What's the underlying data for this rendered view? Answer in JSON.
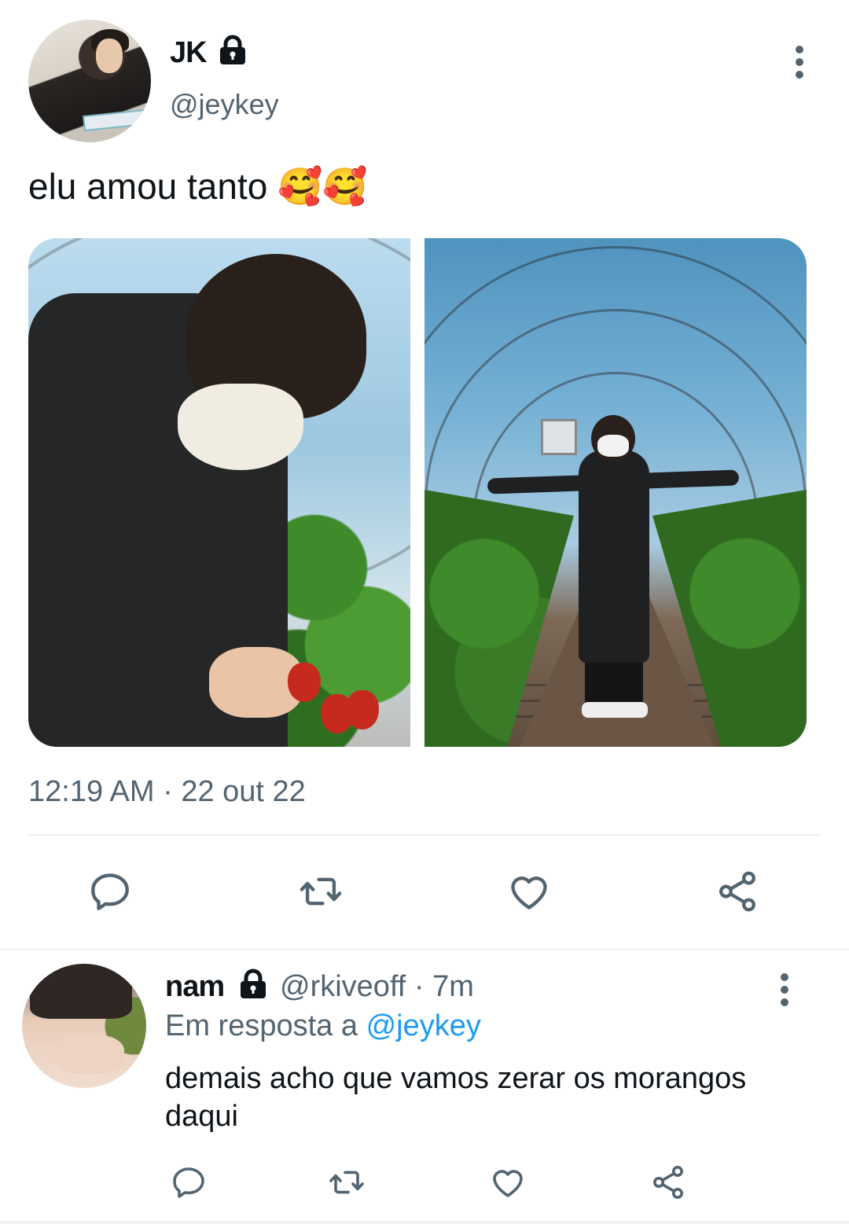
{
  "tweet": {
    "display_name": "JK",
    "handle": "@jeykey",
    "text": "elu amou tanto",
    "emoji": "🥰🥰",
    "timestamp": "12:19 AM · 22 out 22"
  },
  "reply": {
    "display_name": "nam",
    "handle_time": "@rkiveoff · 7m",
    "reply_prefix": "Em resposta a",
    "reply_mention": "@jeykey",
    "text": "demais acho que vamos zerar os morangos daqui"
  },
  "icons": {
    "lock": "lock-icon",
    "more": "more-vertical-icon",
    "reply": "reply-icon",
    "retweet": "retweet-icon",
    "like": "heart-icon",
    "share": "share-icon"
  },
  "colors": {
    "text": "#0f1419",
    "secondary": "#536471",
    "link": "#1d9bf0",
    "divider": "#eff3f4"
  }
}
